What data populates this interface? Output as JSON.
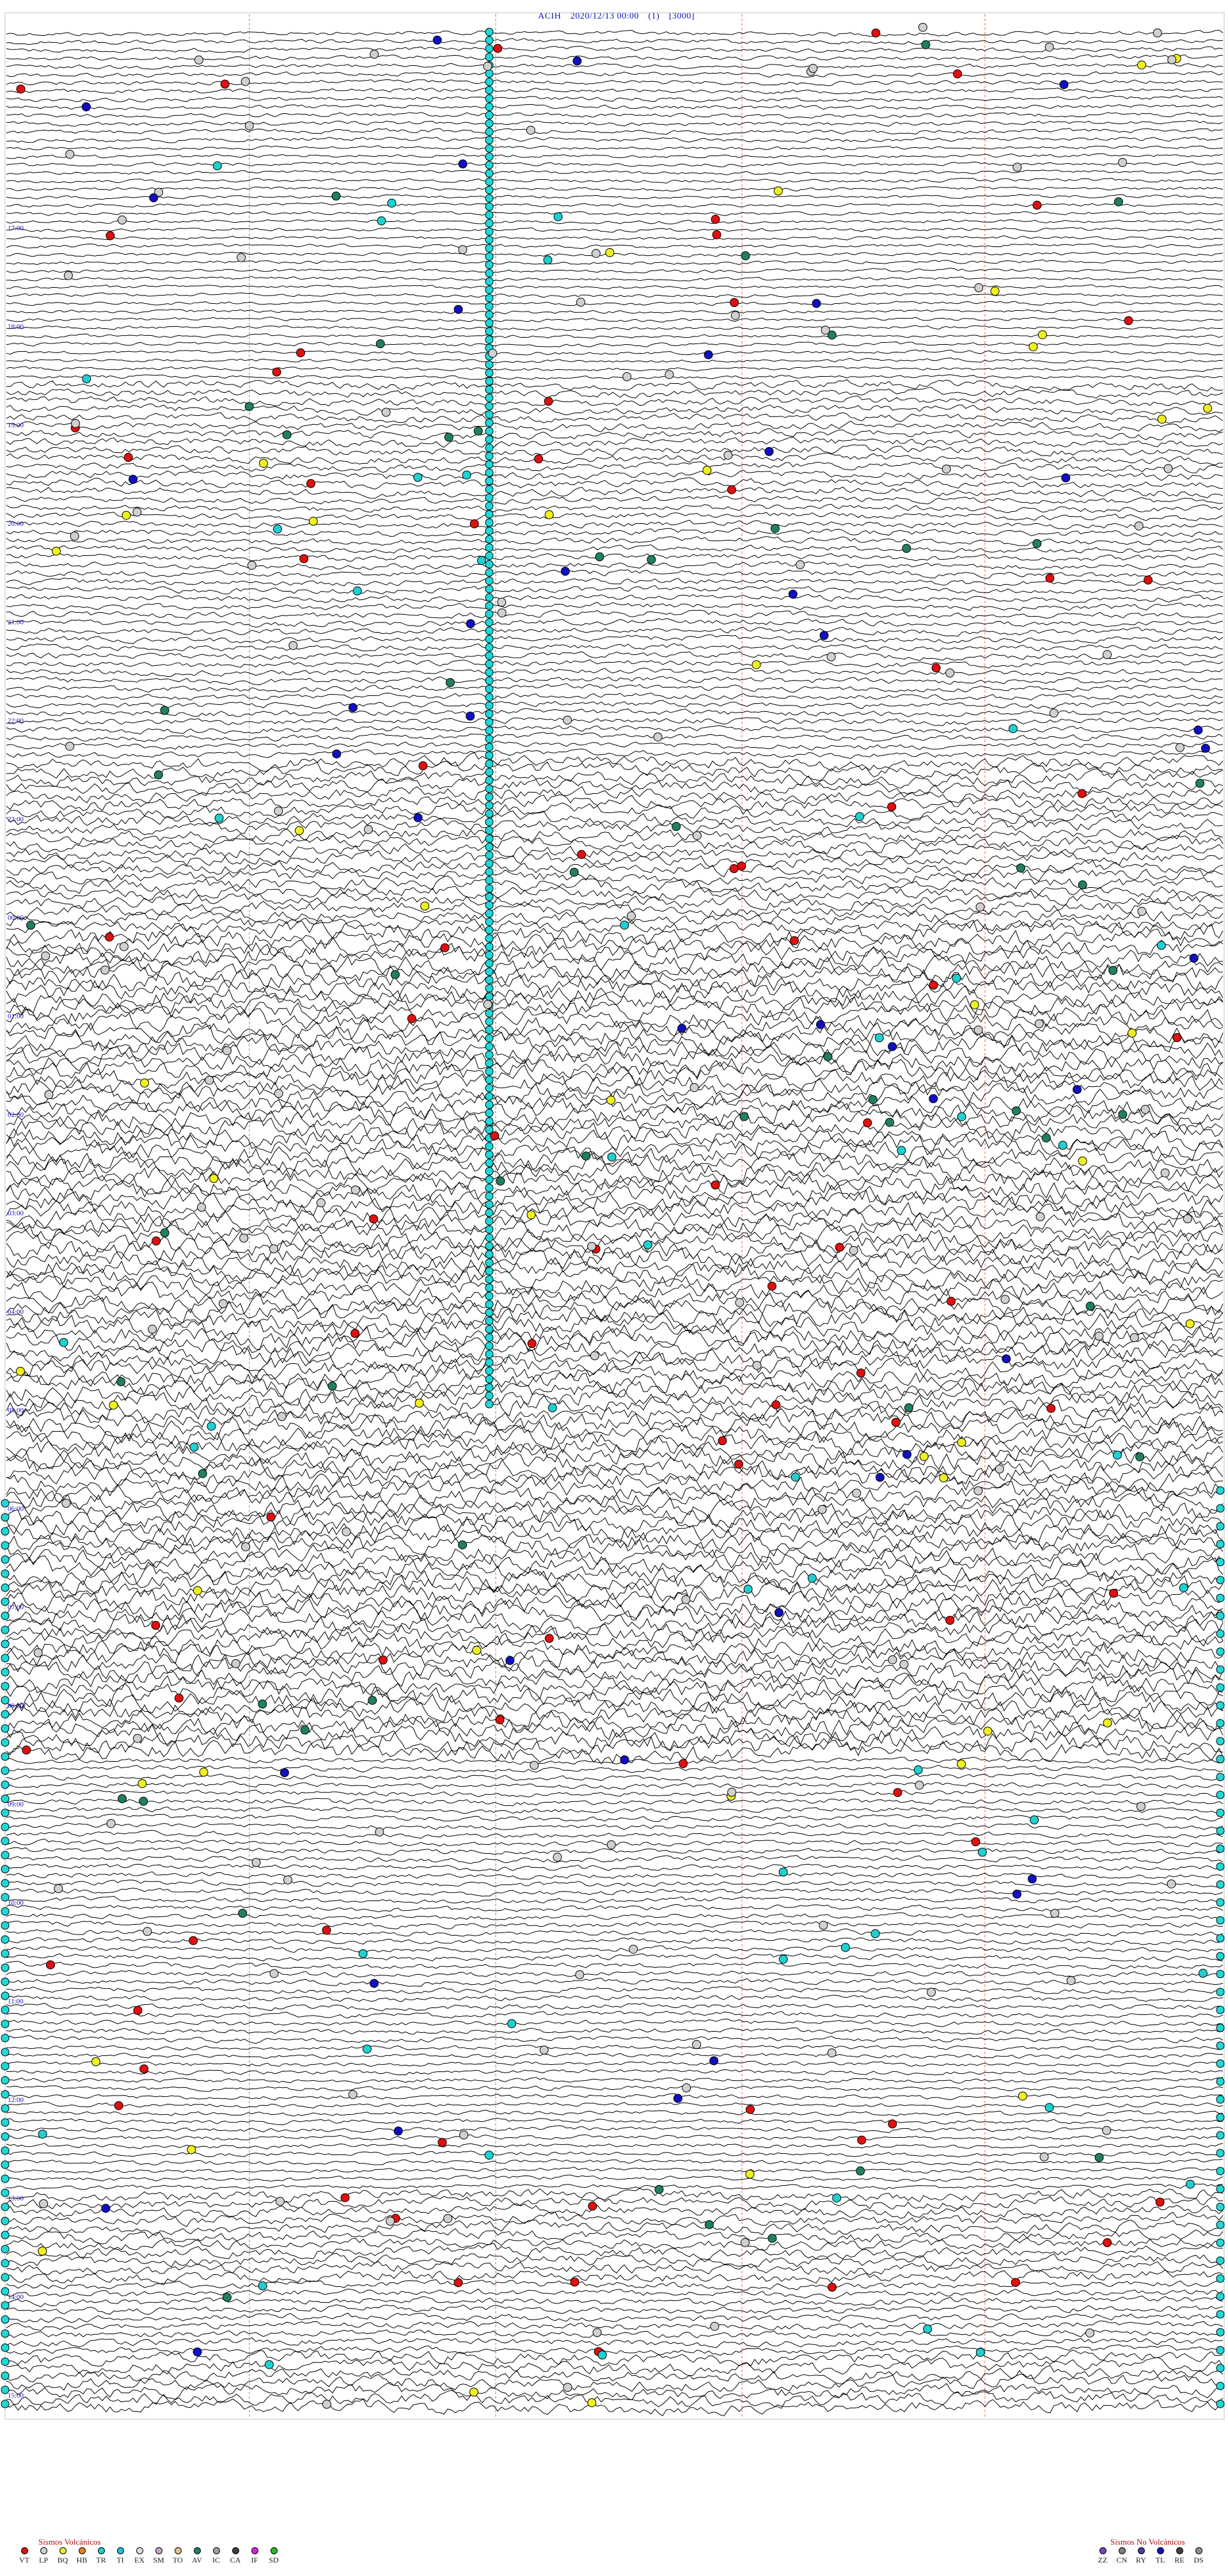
{
  "header": {
    "station": "ACIH",
    "datetime": "2020/12/13 00:00",
    "index": "(1)",
    "count": "[3000]"
  },
  "time_labels": [
    "17:00",
    "18:00",
    "19:00",
    "20:00",
    "21:00",
    "22:00",
    "23:00",
    "00:00",
    "01:00",
    "02:00",
    "03:00",
    "04:00",
    "05:00",
    "06:00",
    "07:00",
    "08:00",
    "09:00",
    "10:00",
    "11:00",
    "12:00",
    "13:00",
    "14:00",
    "15:00",
    "16:00"
  ],
  "legend_volcanic": {
    "title": "Sismos Volcánicos",
    "items": [
      {
        "code": "VT",
        "color": "#e01010"
      },
      {
        "code": "LP",
        "color": "#d0d0d0"
      },
      {
        "code": "BQ",
        "color": "#f0f020"
      },
      {
        "code": "HB",
        "color": "#f08020"
      },
      {
        "code": "TR",
        "color": "#20d0d0"
      },
      {
        "code": "TI",
        "color": "#20c0e0"
      },
      {
        "code": "EX",
        "color": "#e0e0e0"
      },
      {
        "code": "SM",
        "color": "#d0a0d0"
      },
      {
        "code": "TO",
        "color": "#e0c090"
      },
      {
        "code": "AV",
        "color": "#208060"
      },
      {
        "code": "IC",
        "color": "#a0a0a0"
      },
      {
        "code": "CA",
        "color": "#404040"
      },
      {
        "code": "IF",
        "color": "#e020e0"
      },
      {
        "code": "SD",
        "color": "#20c020"
      }
    ]
  },
  "legend_nonvolcanic": {
    "title": "Sismos No Volcánicos",
    "items": [
      {
        "code": "ZZ",
        "color": "#8040c0"
      },
      {
        "code": "CN",
        "color": "#808080"
      },
      {
        "code": "RY",
        "color": "#4040a0"
      },
      {
        "code": "TL",
        "color": "#1010c0"
      },
      {
        "code": "RE",
        "color": "#404040"
      },
      {
        "code": "DS",
        "color": "#909090"
      }
    ]
  },
  "colors": {
    "trace": "#000000",
    "minute_marker": "#f0a080",
    "hour_label": "#1010c0",
    "cyan_marker": "#20d8d8"
  }
}
